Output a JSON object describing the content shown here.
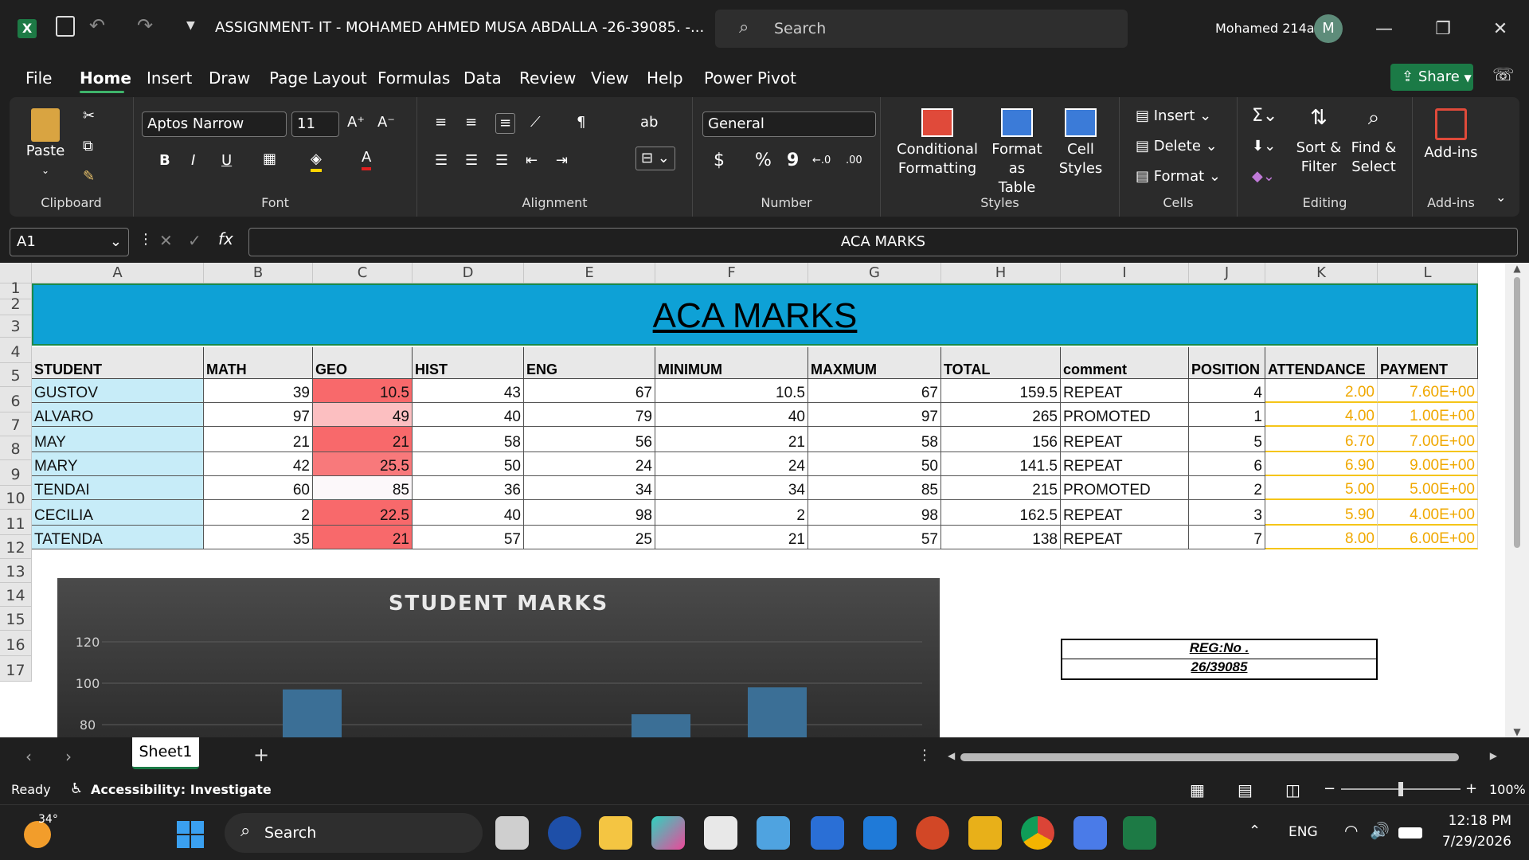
{
  "titlebar": {
    "doc_title": "ASSIGNMENT- IT - MOHAMED AHMED MUSA ABDALLA -26-39085.  -...",
    "search_placeholder": "Search",
    "user_name": "Mohamed 214a",
    "avatar_letter": "M"
  },
  "menu": [
    "File",
    "Home",
    "Insert",
    "Draw",
    "Page Layout",
    "Formulas",
    "Data",
    "Review",
    "View",
    "Help",
    "Power Pivot"
  ],
  "share_label": "Share",
  "ribbon": {
    "clipboard": {
      "paste": "Paste",
      "label": "Clipboard"
    },
    "font": {
      "name": "Aptos Narrow",
      "size": "11",
      "label": "Font",
      "bold": "B",
      "italic": "I",
      "underline": "U"
    },
    "alignment": {
      "label": "Alignment"
    },
    "number": {
      "format": "General",
      "label": "Number",
      "currency": "$",
      "percent": "%",
      "comma": "9"
    },
    "styles": {
      "cond_l1": "Conditional",
      "cond_l2": "Formatting",
      "fmt_l1": "Format as",
      "fmt_l2": "Table",
      "cell_l1": "Cell",
      "cell_l2": "Styles",
      "label": "Styles"
    },
    "cells": {
      "insert": "Insert",
      "delete": "Delete",
      "format": "Format",
      "label": "Cells"
    },
    "editing": {
      "sort_l1": "Sort &",
      "sort_l2": "Filter",
      "find_l1": "Find &",
      "find_l2": "Select",
      "label": "Editing"
    },
    "addins": {
      "btn": "Add-ins",
      "label": "Add-ins"
    }
  },
  "formula_bar": {
    "name_box": "A1",
    "fx": "fx",
    "content": "ACA MARKS"
  },
  "columns": [
    "A",
    "B",
    "C",
    "D",
    "E",
    "F",
    "G",
    "H",
    "I",
    "J",
    "K",
    "L"
  ],
  "rows": [
    "1",
    "2",
    "3",
    "4",
    "5",
    "6",
    "7",
    "8",
    "9",
    "10",
    "11",
    "12",
    "13",
    "14",
    "15",
    "16",
    "17"
  ],
  "sheet_title": "ACA MARKS",
  "headers": [
    "STUDENT",
    "MATH",
    "GEO",
    "HIST",
    "ENG",
    "MINIMUM",
    "MAXMUM",
    "TOTAL",
    "comment",
    "POSITION",
    "ATTENDANCE",
    "PAYMENT"
  ],
  "table": [
    [
      "GUSTOV",
      "39",
      "10.5",
      "43",
      "67",
      "10.5",
      "67",
      "159.5",
      "REPEAT",
      "4",
      "2.00",
      "7.60E+00"
    ],
    [
      "ALVARO",
      "97",
      "49",
      "40",
      "79",
      "40",
      "97",
      "265",
      "PROMOTED",
      "1",
      "4.00",
      "1.00E+00"
    ],
    [
      "MAY",
      "21",
      "21",
      "58",
      "56",
      "21",
      "58",
      "156",
      "REPEAT",
      "5",
      "6.70",
      "7.00E+00"
    ],
    [
      "MARY",
      "42",
      "25.5",
      "50",
      "24",
      "24",
      "50",
      "141.5",
      "REPEAT",
      "6",
      "6.90",
      "9.00E+00"
    ],
    [
      "TENDAI",
      "60",
      "85",
      "36",
      "34",
      "34",
      "85",
      "215",
      "PROMOTED",
      "2",
      "5.00",
      "5.00E+00"
    ],
    [
      "CECILIA",
      "2",
      "22.5",
      "40",
      "98",
      "2",
      "98",
      "162.5",
      "REPEAT",
      "3",
      "5.90",
      "4.00E+00"
    ],
    [
      "TATENDA",
      "35",
      "21",
      "57",
      "25",
      "21",
      "57",
      "138",
      "REPEAT",
      "7",
      "8.00",
      "6.00E+00"
    ]
  ],
  "geo_colors": [
    "#f8696b",
    "#fcbfc1",
    "#f8696b",
    "#f8797b",
    "#fcf8fa",
    "#f8696b",
    "#f8696b"
  ],
  "reg_box": {
    "label": "REG:No .",
    "value": "26/39085"
  },
  "chart_data": {
    "type": "bar",
    "title": "STUDENT MARKS",
    "y_ticks": [
      "120",
      "100",
      "80"
    ],
    "visible_y_range": [
      75,
      125
    ],
    "visible_bars": [
      {
        "category_index": 1,
        "value": 97
      },
      {
        "category_index": 4,
        "value": 85
      },
      {
        "category_index": 5,
        "value": 98
      }
    ]
  },
  "sheet_tab": "Sheet1",
  "status": {
    "ready": "Ready",
    "accessibility": "Accessibility: Investigate",
    "zoom": "100%"
  },
  "taskbar": {
    "temp": "34°",
    "search": "Search",
    "lang": "ENG",
    "time": "12:18 PM",
    "date": "7/29/2026"
  }
}
